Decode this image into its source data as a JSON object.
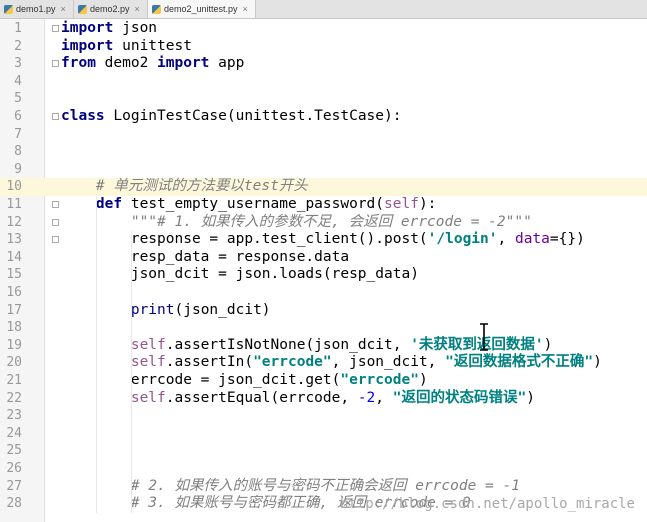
{
  "tabs": [
    {
      "label": "demo1.py",
      "active": false
    },
    {
      "label": "demo2.py",
      "active": false
    },
    {
      "label": "demo2_unittest.py",
      "active": true
    }
  ],
  "highlighted_line": "10",
  "lines": [
    {
      "n": "1",
      "text": "import json"
    },
    {
      "n": "2",
      "text": "import unittest"
    },
    {
      "n": "3",
      "text": "from demo2 import app"
    },
    {
      "n": "4",
      "text": ""
    },
    {
      "n": "5",
      "text": ""
    },
    {
      "n": "6",
      "text": "class LoginTestCase(unittest.TestCase):"
    },
    {
      "n": "7",
      "text": ""
    },
    {
      "n": "8",
      "text": ""
    },
    {
      "n": "9",
      "text": ""
    },
    {
      "n": "10",
      "text": "    # 单元测试的方法要以test开头"
    },
    {
      "n": "11",
      "text": "    def test_empty_username_password(self):"
    },
    {
      "n": "12",
      "text": "        \"\"\"# 1. 如果传入的参数不足, 会返回 errcode = -2\"\"\""
    },
    {
      "n": "13",
      "text": "        response = app.test_client().post('/login', data={})"
    },
    {
      "n": "14",
      "text": "        resp_data = response.data"
    },
    {
      "n": "15",
      "text": "        json_dcit = json.loads(resp_data)"
    },
    {
      "n": "16",
      "text": ""
    },
    {
      "n": "17",
      "text": "        print(json_dcit)"
    },
    {
      "n": "18",
      "text": ""
    },
    {
      "n": "19",
      "text": "        self.assertIsNotNone(json_dcit, '未获取到返回数据')"
    },
    {
      "n": "20",
      "text": "        self.assertIn(\"errcode\", json_dcit, \"返回数据格式不正确\")"
    },
    {
      "n": "21",
      "text": "        errcode = json_dcit.get(\"errcode\")"
    },
    {
      "n": "22",
      "text": "        self.assertEqual(errcode, -2, \"返回的状态码错误\")"
    },
    {
      "n": "23",
      "text": ""
    },
    {
      "n": "24",
      "text": ""
    },
    {
      "n": "25",
      "text": ""
    },
    {
      "n": "26",
      "text": ""
    },
    {
      "n": "27",
      "text": "        # 2. 如果传入的账号与密码不正确会返回 errcode = -1"
    },
    {
      "n": "28",
      "text": "        # 3. 如果账号与密码都正确, 返回 errcode = 0"
    }
  ],
  "colors": {
    "keyword": "#000080",
    "self": "#94558d",
    "string": "#008080",
    "comment": "#808080",
    "number": "#0000ff",
    "param": "#660099"
  },
  "icons": [
    "python-file-icon",
    "close-tab-icon",
    "text-cursor-icon",
    "fold-icon"
  ],
  "watermark": "http://blog.csdn.net/apollo_miracle"
}
